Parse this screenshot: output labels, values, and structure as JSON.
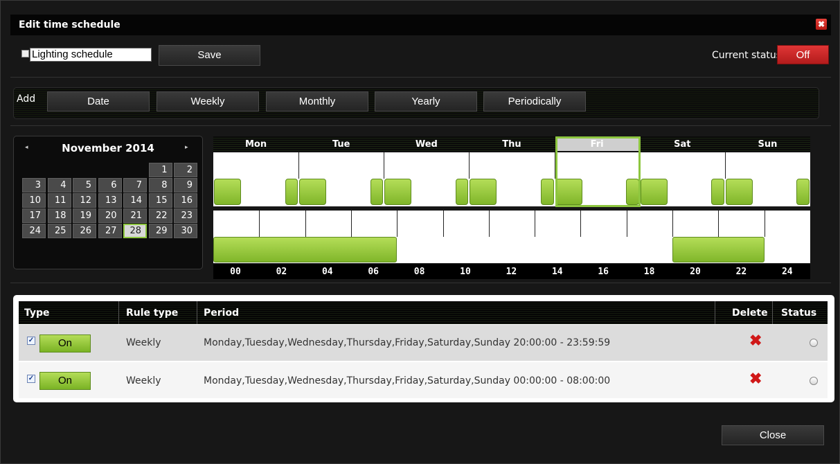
{
  "dialog": {
    "title": "Edit time schedule",
    "close_icon": "close-icon",
    "close_glyph": "✖"
  },
  "schedule": {
    "name": "Lighting schedule",
    "enabled": false,
    "save_label": "Save"
  },
  "status": {
    "label": "Current status",
    "value": "Off",
    "color": "#d42a2a"
  },
  "add_bar": {
    "label": "Add",
    "buttons": [
      "Date",
      "Weekly",
      "Monthly",
      "Yearly",
      "Periodically"
    ]
  },
  "calendar": {
    "month_label": "November 2014",
    "prev_glyph": "◂",
    "next_glyph": "▸",
    "leading_blanks": 5,
    "days": 30,
    "selected_day": 28
  },
  "week": {
    "days": [
      "Mon",
      "Tue",
      "Wed",
      "Thu",
      "Fri",
      "Sat",
      "Sun"
    ],
    "selected_day": "Fri"
  },
  "day_timeline": {
    "hour_labels": [
      "00",
      "02",
      "04",
      "06",
      "08",
      "10",
      "12",
      "14",
      "16",
      "18",
      "20",
      "22",
      "24"
    ],
    "on_ranges": [
      [
        "00:00:00",
        "08:00:00"
      ],
      [
        "20:00:00",
        "23:59:59"
      ]
    ]
  },
  "rules": {
    "headers": {
      "type": "Type",
      "rule_type": "Rule type",
      "period": "Period",
      "delete": "Delete",
      "status": "Status"
    },
    "rows": [
      {
        "checked": true,
        "type_label": "On",
        "rule_type": "Weekly",
        "period": "Monday,Tuesday,Wednesday,Thursday,Friday,Saturday,Sunday 20:00:00 - 23:59:59",
        "delete_glyph": "✖"
      },
      {
        "checked": true,
        "type_label": "On",
        "rule_type": "Weekly",
        "period": "Monday,Tuesday,Wednesday,Thursday,Friday,Saturday,Sunday 00:00:00 - 08:00:00",
        "delete_glyph": "✖"
      }
    ]
  },
  "footer": {
    "close_label": "Close"
  },
  "colors": {
    "accent_green": "#8dc63f",
    "off_red": "#d42a2a",
    "delete_red": "#d01818"
  }
}
